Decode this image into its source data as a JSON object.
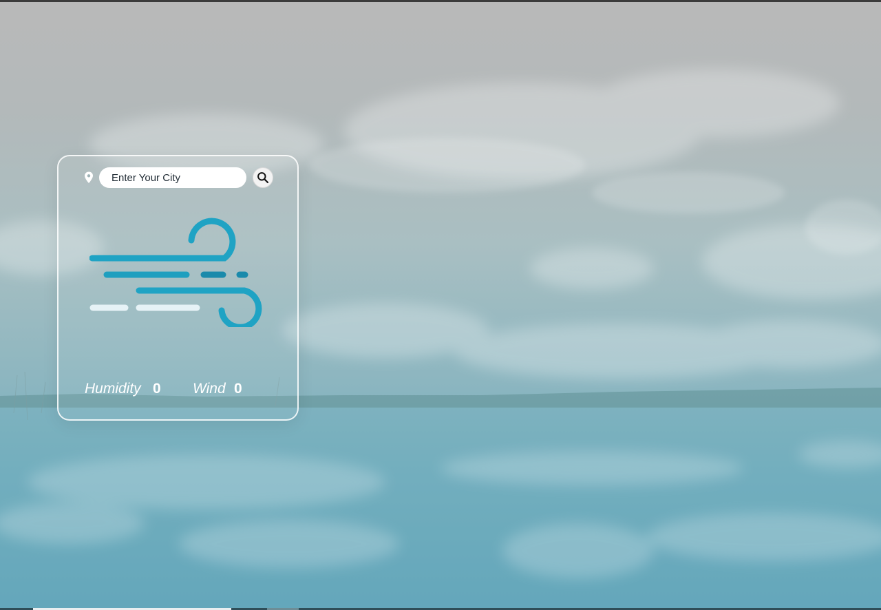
{
  "search": {
    "placeholder": "Enter Your City",
    "value": ""
  },
  "weather": {
    "icon": "wind-icon",
    "humidity_label": "Humidity",
    "humidity_value": "0",
    "wind_label": "Wind",
    "wind_value": "0"
  },
  "colors": {
    "accent": "#1fa3c4",
    "card_border": "#ffffff",
    "text": "#ffffff"
  }
}
